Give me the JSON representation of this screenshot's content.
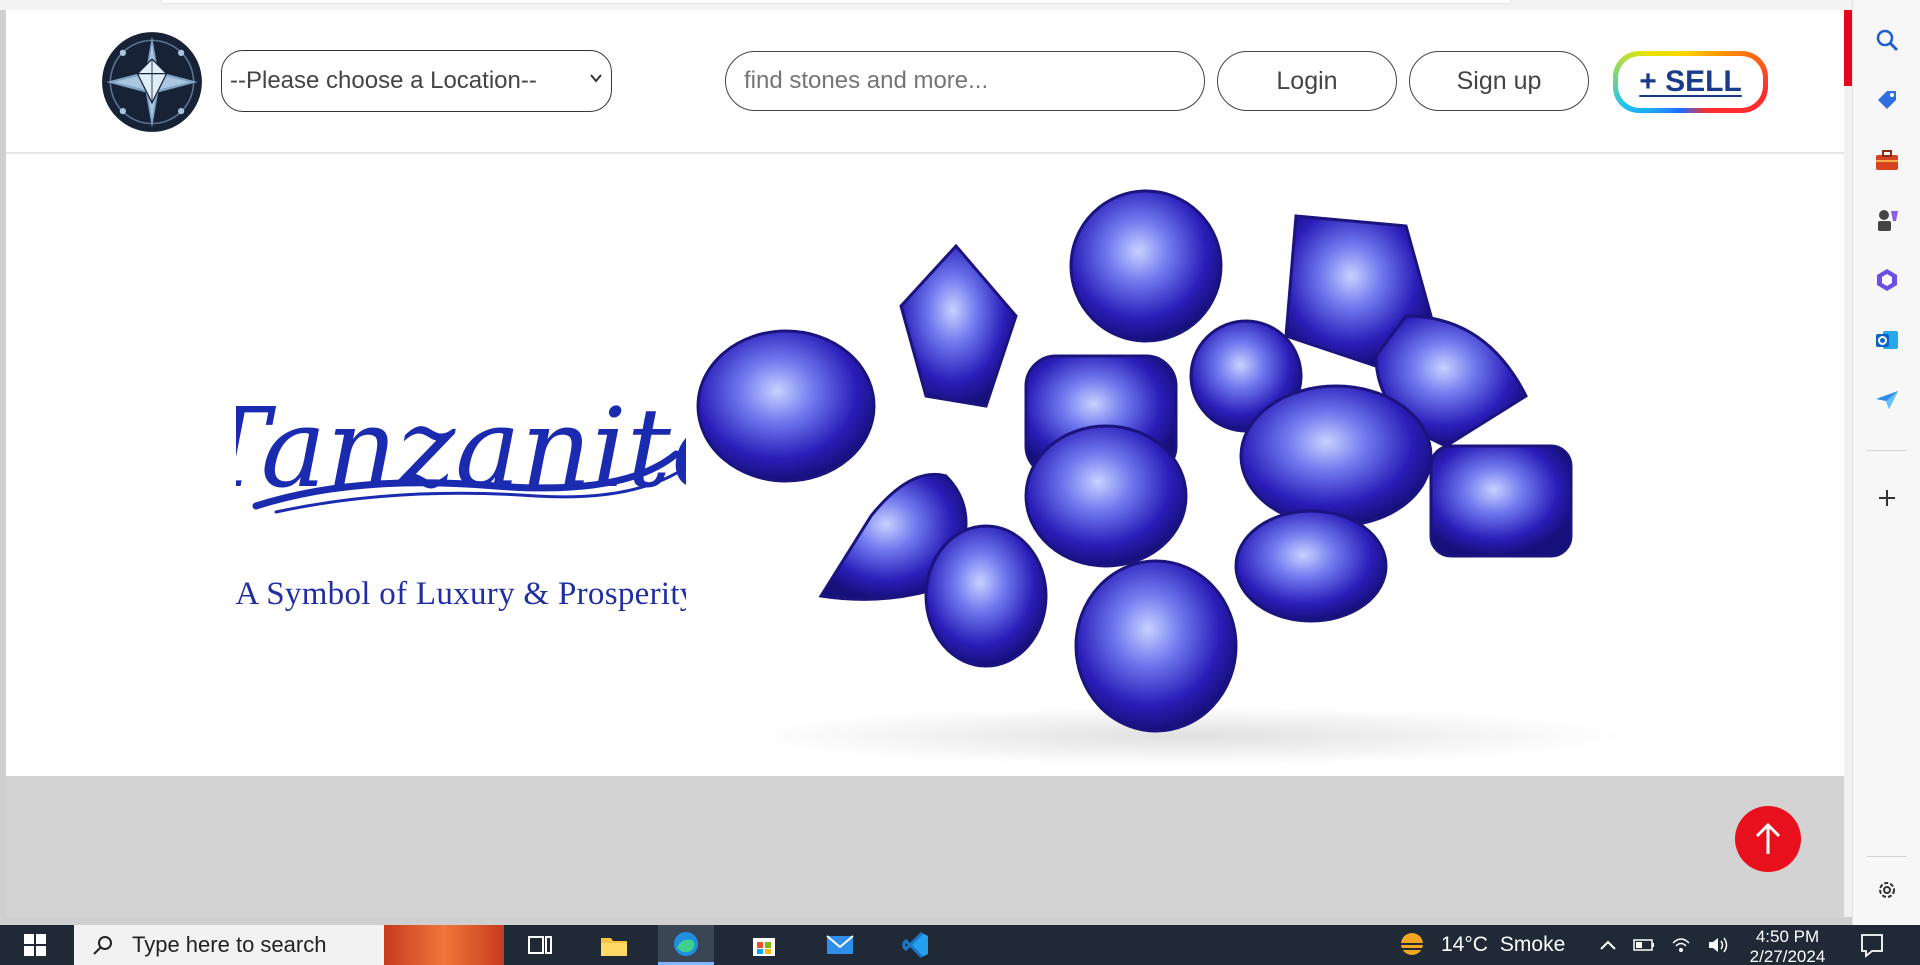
{
  "header": {
    "location_select": {
      "value": "--Please choose a Location--"
    },
    "search": {
      "placeholder": "find stones and more..."
    },
    "login_label": "Login",
    "signup_label": "Sign up",
    "sell_label": "+ SELL"
  },
  "hero": {
    "brand_word": "Tanzanite",
    "tagline": "A Symbol of Luxury & Prosperity"
  },
  "colors": {
    "brand_blue": "#1a2bb0",
    "scroll_top_red": "#e8101c",
    "scroll_thumb_red": "#e1071c",
    "band_gray": "#d3d3d3"
  },
  "edge_sidebar": {
    "icons": [
      "search-icon",
      "shopping-tag-icon",
      "tools-briefcase-icon",
      "games-icon",
      "copilot-icon",
      "outlook-icon",
      "send-icon",
      "add-icon",
      "settings-icon"
    ]
  },
  "taskbar": {
    "search_placeholder": "Type here to search",
    "apps": [
      "task-view",
      "file-explorer",
      "edge",
      "microsoft-store",
      "mail",
      "vs-code"
    ],
    "weather": {
      "temp": "14°C",
      "condition": "Smoke"
    },
    "clock": {
      "time": "4:50 PM",
      "date": "2/27/2024"
    }
  }
}
